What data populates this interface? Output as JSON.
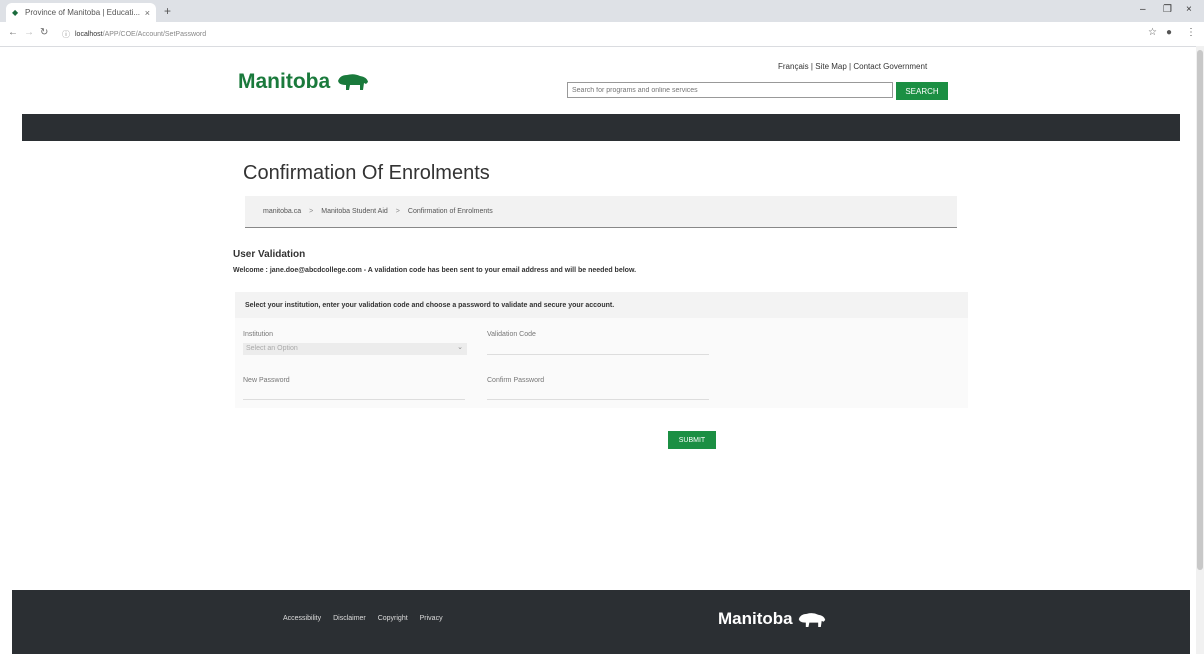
{
  "browser": {
    "tab_title": "Province of Manitoba | Educati...",
    "tab_close": "×",
    "new_tab": "+",
    "url_host": "localhost",
    "url_path": "/APP/COE/Account/SetPassword",
    "window_controls": [
      "–",
      "❐",
      "×"
    ]
  },
  "header": {
    "logo_text": "Manitoba",
    "links": [
      "Français",
      "Site Map",
      "Contact Government"
    ],
    "search_placeholder": "Search for programs and online services",
    "search_button": "SEARCH"
  },
  "page": {
    "title": "Confirmation Of Enrolments",
    "breadcrumb": [
      "manitoba.ca",
      "Manitoba Student Aid",
      "Confirmation of Enrolments"
    ],
    "breadcrumb_sep": ">"
  },
  "form": {
    "section_title": "User Validation",
    "welcome": "Welcome : jane.doe@abcdcollege.com - A validation code has been sent to your email address and will be needed below.",
    "instruction": "Select your institution, enter your validation code and choose a password to validate and secure your account.",
    "institution_label": "Institution",
    "institution_value": "Select an Option",
    "validation_code_label": "Validation Code",
    "new_password_label": "New Password",
    "confirm_password_label": "Confirm Password",
    "submit_label": "SUBMIT"
  },
  "footer": {
    "links": [
      "Accessibility",
      "Disclaimer",
      "Copyright",
      "Privacy"
    ],
    "logo_text": "Manitoba"
  },
  "colors": {
    "brand_green": "#1b8f43",
    "dark_bar": "#2b2f33"
  }
}
